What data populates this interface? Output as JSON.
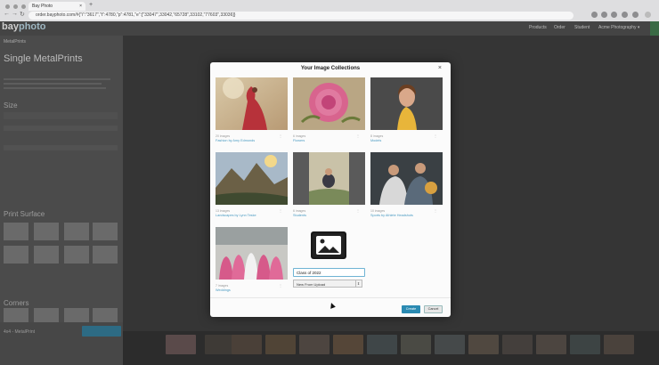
{
  "browser": {
    "tab_title": "Bay Photo",
    "tab_close": "×",
    "new_tab": "+",
    "url": "order.bayphoto.com/#{\"i\":\"3617\",\"t\":4780,\"p\":4781,\"e\":[\"33047\",33042,\"65728\",33102,\"77603\",33036]}"
  },
  "app": {
    "logo_main": "bay",
    "logo_accent": "photo",
    "nav": {
      "products": "Products",
      "order": "Order",
      "student": "Student",
      "account": "Acme Photography ▾"
    }
  },
  "sidebar": {
    "header": "MetalPrints",
    "title": "Single MetalPrints",
    "size": "Size",
    "surface": "Print Surface",
    "corners": "Corners",
    "footer": "4x4 - MetalPrint"
  },
  "modal": {
    "title": "Your Image Collections",
    "close": "×",
    "collections": [
      {
        "count": "20 images",
        "name": "Fashion by Amy Edmonds"
      },
      {
        "count": "6 images",
        "name": "Flowers"
      },
      {
        "count": "8 images",
        "name": "Models"
      },
      {
        "count": "13 images",
        "name": "Landscapes by Lynn Teske"
      },
      {
        "count": "6 images",
        "name": "Students"
      },
      {
        "count": "10 images",
        "name": "Sports by Athlete Headshots"
      },
      {
        "count": "7 images",
        "name": "Weddings"
      }
    ],
    "new_collection_value": "Class of 2022",
    "source_select": "New From Upload",
    "create": "Create",
    "cancel": "Cancel"
  },
  "icons": {
    "picture": "image-placeholder-icon",
    "kebab": "more-options-icon",
    "close": "close-icon"
  }
}
